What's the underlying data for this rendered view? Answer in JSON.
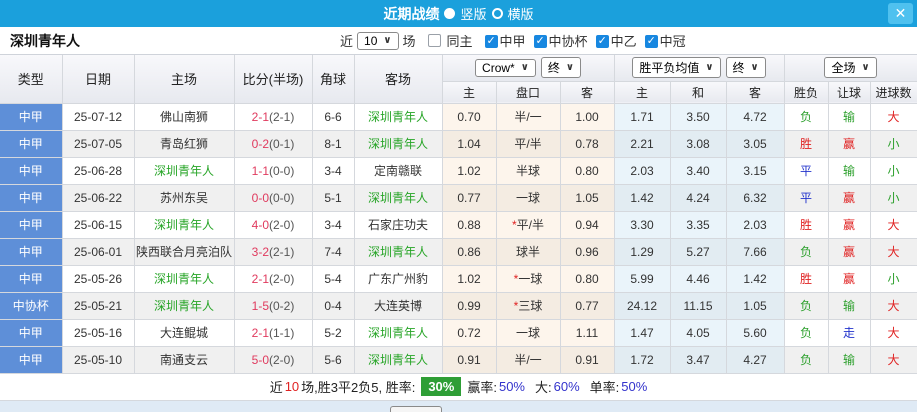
{
  "titlebar": {
    "title": "近期战绩",
    "portrait_label": "竖版",
    "landscape_label": "横版",
    "selected_layout": "竖版",
    "close_icon": "✕"
  },
  "filterbar": {
    "team": "深圳青年人",
    "near_label": "近",
    "match_count": "10",
    "games_label": "场",
    "same_home": {
      "label": "同主",
      "checked": false
    },
    "leagues": [
      {
        "label": "中甲",
        "checked": true
      },
      {
        "label": "中协杯",
        "checked": true
      },
      {
        "label": "中乙",
        "checked": true
      },
      {
        "label": "中冠",
        "checked": true
      }
    ]
  },
  "selectors": {
    "bookmaker": "Crow*",
    "bookmaker_stage": "终",
    "avg_type": "胜平负均值",
    "avg_stage": "终",
    "scope": "全场"
  },
  "table": {
    "main_headers": [
      "类型",
      "日期",
      "主场",
      "比分(半场)",
      "角球",
      "客场"
    ],
    "sub_headers": [
      "主",
      "盘口",
      "客",
      "主",
      "和",
      "客",
      "胜负",
      "让球",
      "进球数"
    ]
  },
  "rows": [
    {
      "type": "中甲",
      "date": "25-07-12",
      "home": "佛山南狮",
      "score": "2-1",
      "half": "(2-1)",
      "corners": "6-6",
      "away": "深圳青年人",
      "odds_home": "0.70",
      "handicap": "半/一",
      "odds_away": "1.00",
      "avg_home": "1.71",
      "avg_draw": "3.50",
      "avg_away": "4.72",
      "result_wdl": "负",
      "result_handicap": "输",
      "result_goals": "大"
    },
    {
      "type": "中甲",
      "date": "25-07-05",
      "home": "青岛红狮",
      "score": "0-2",
      "half": "(0-1)",
      "corners": "8-1",
      "away": "深圳青年人",
      "odds_home": "1.04",
      "handicap": "平/半",
      "odds_away": "0.78",
      "avg_home": "2.21",
      "avg_draw": "3.08",
      "avg_away": "3.05",
      "result_wdl": "胜",
      "result_handicap": "赢",
      "result_goals": "小"
    },
    {
      "type": "中甲",
      "date": "25-06-28",
      "home": "深圳青年人",
      "score": "1-1",
      "half": "(0-0)",
      "corners": "3-4",
      "away": "定南赣联",
      "odds_home": "1.02",
      "handicap": "半球",
      "odds_away": "0.80",
      "avg_home": "2.03",
      "avg_draw": "3.40",
      "avg_away": "3.15",
      "result_wdl": "平",
      "result_handicap": "输",
      "result_goals": "小"
    },
    {
      "type": "中甲",
      "date": "25-06-22",
      "home": "苏州东吴",
      "score": "0-0",
      "half": "(0-0)",
      "corners": "5-1",
      "away": "深圳青年人",
      "odds_home": "0.77",
      "handicap": "一球",
      "odds_away": "1.05",
      "avg_home": "1.42",
      "avg_draw": "4.24",
      "avg_away": "6.32",
      "result_wdl": "平",
      "result_handicap": "赢",
      "result_goals": "小"
    },
    {
      "type": "中甲",
      "date": "25-06-15",
      "home": "深圳青年人",
      "score": "4-0",
      "half": "(2-0)",
      "corners": "3-4",
      "away": "石家庄功夫",
      "odds_home": "0.88",
      "handicap": "*平/半",
      "odds_away": "0.94",
      "avg_home": "3.30",
      "avg_draw": "3.35",
      "avg_away": "2.03",
      "result_wdl": "胜",
      "result_handicap": "赢",
      "result_goals": "大"
    },
    {
      "type": "中甲",
      "date": "25-06-01",
      "home": "陕西联合月亮泊队",
      "score": "3-2",
      "half": "(2-1)",
      "corners": "7-4",
      "away": "深圳青年人",
      "odds_home": "0.86",
      "handicap": "球半",
      "odds_away": "0.96",
      "avg_home": "1.29",
      "avg_draw": "5.27",
      "avg_away": "7.66",
      "result_wdl": "负",
      "result_handicap": "赢",
      "result_goals": "大"
    },
    {
      "type": "中甲",
      "date": "25-05-26",
      "home": "深圳青年人",
      "score": "2-1",
      "half": "(2-0)",
      "corners": "5-4",
      "away": "广东广州豹",
      "odds_home": "1.02",
      "handicap": "*一球",
      "odds_away": "0.80",
      "avg_home": "5.99",
      "avg_draw": "4.46",
      "avg_away": "1.42",
      "result_wdl": "胜",
      "result_handicap": "赢",
      "result_goals": "小"
    },
    {
      "type": "中协杯",
      "date": "25-05-21",
      "home": "深圳青年人",
      "score": "1-5",
      "half": "(0-2)",
      "corners": "0-4",
      "away": "大连英博",
      "odds_home": "0.99",
      "handicap": "*三球",
      "odds_away": "0.77",
      "avg_home": "24.12",
      "avg_draw": "11.15",
      "avg_away": "1.05",
      "result_wdl": "负",
      "result_handicap": "输",
      "result_goals": "大"
    },
    {
      "type": "中甲",
      "date": "25-05-16",
      "home": "大连鲲城",
      "score": "2-1",
      "half": "(1-1)",
      "corners": "5-2",
      "away": "深圳青年人",
      "odds_home": "0.72",
      "handicap": "一球",
      "odds_away": "1.11",
      "avg_home": "1.47",
      "avg_draw": "4.05",
      "avg_away": "5.60",
      "result_wdl": "负",
      "result_handicap": "走",
      "result_goals": "大"
    },
    {
      "type": "中甲",
      "date": "25-05-10",
      "home": "南通支云",
      "score": "5-0",
      "half": "(2-0)",
      "corners": "5-6",
      "away": "深圳青年人",
      "odds_home": "0.91",
      "handicap": "半/一",
      "odds_away": "0.91",
      "avg_home": "1.72",
      "avg_draw": "3.47",
      "avg_away": "4.27",
      "result_wdl": "负",
      "result_handicap": "输",
      "result_goals": "大"
    }
  ],
  "summary": {
    "near_label": "近",
    "games": "10",
    "record_text": "场,胜3平2负5, 胜率:",
    "win_rate": "30%",
    "handicap_label": "赢率:",
    "handicap_rate": "50%",
    "big_label": "大:",
    "big_rate": "60%",
    "single_label": "单率:",
    "single_rate": "50%"
  },
  "colors": {
    "accent_blue": "#1ba0dc",
    "type_cell_blue": "#5e8fd8",
    "win_red": "#e02222",
    "lose_green": "#2da02d",
    "draw_blue": "#2233cc",
    "score_red": "#e03a5e",
    "rate_box_green": "#2e9e36"
  }
}
